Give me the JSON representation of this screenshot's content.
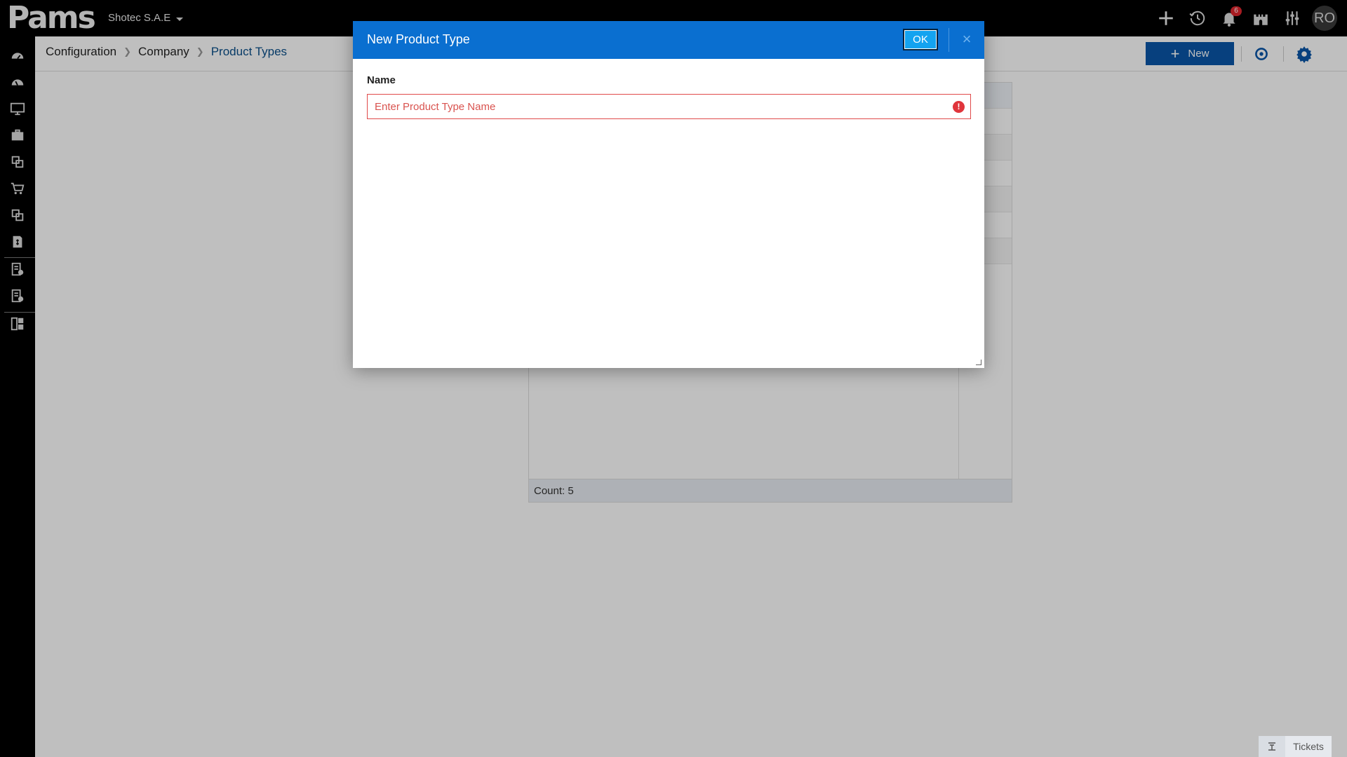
{
  "topbar": {
    "logo_text": "Pams",
    "company": "Shotec S.A.E",
    "notifications_count": "6",
    "avatar_initials": "RO"
  },
  "breadcrumb": {
    "items": [
      "Configuration",
      "Company",
      "Product Types"
    ]
  },
  "toolbar": {
    "new_label": "New"
  },
  "grid": {
    "footer_count": "Count: 5"
  },
  "modal": {
    "title": "New Product Type",
    "ok_label": "OK",
    "close_label": "×",
    "name_label": "Name",
    "name_placeholder": "Enter Product Type Name",
    "name_value": "",
    "error_glyph": "!"
  },
  "tickets": {
    "label": "Tickets"
  },
  "colors": {
    "accent": "#0a6fd0",
    "button_blue": "#0a56a8",
    "ok_blue": "#14a3f0",
    "error_red": "#e0353c"
  }
}
